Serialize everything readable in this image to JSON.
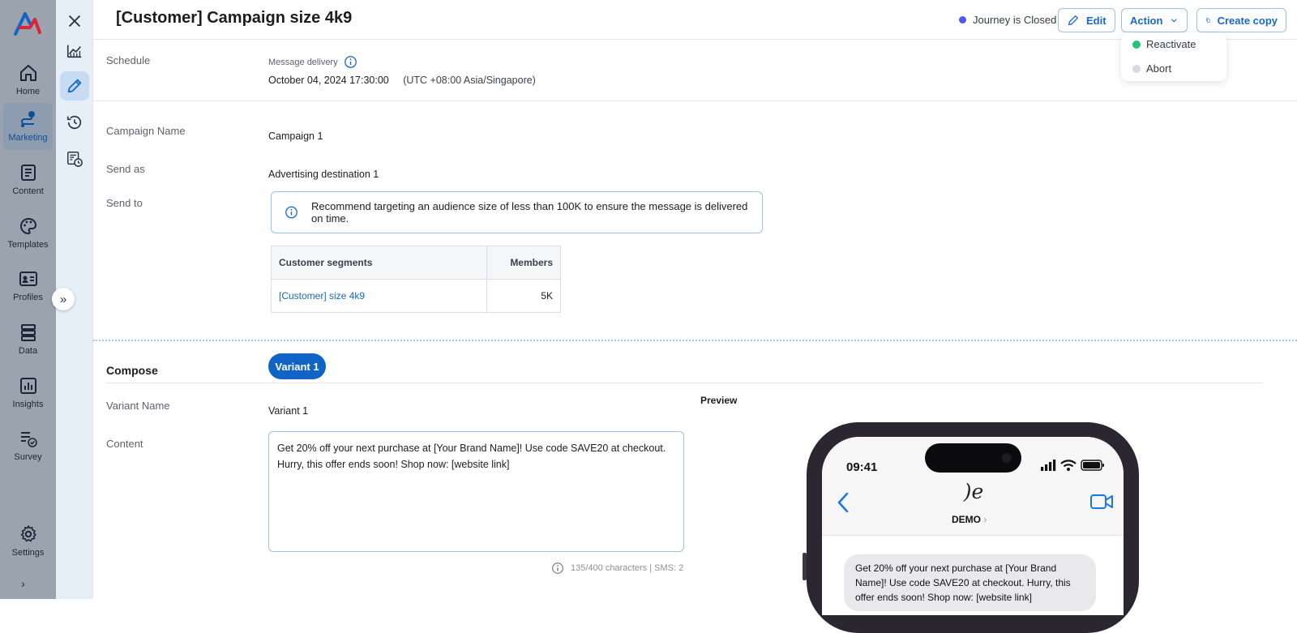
{
  "nav": {
    "items": [
      {
        "label": "Home",
        "icon": "home-icon"
      },
      {
        "label": "Marketing",
        "icon": "marketing-icon"
      },
      {
        "label": "Content",
        "icon": "content-icon"
      },
      {
        "label": "Templates",
        "icon": "palette-icon"
      },
      {
        "label": "Profiles",
        "icon": "profile-card-icon"
      },
      {
        "label": "Data",
        "icon": "database-icon"
      },
      {
        "label": "Insights",
        "icon": "insights-icon"
      },
      {
        "label": "Survey",
        "icon": "survey-icon"
      },
      {
        "label": "Settings",
        "icon": "gear-icon"
      }
    ],
    "active": "Marketing"
  },
  "header": {
    "title": "[Customer] Campaign size 4k9",
    "status_text": "Journey is Closed",
    "edit_label": "Edit",
    "action_label": "Action",
    "create_copy_label": "Create copy"
  },
  "action_menu": {
    "items": [
      {
        "label": "Reactivate",
        "color": "#22c37a"
      },
      {
        "label": "Abort",
        "color": "#d5dae1"
      }
    ]
  },
  "schedule": {
    "label": "Schedule",
    "delivery_label": "Message delivery",
    "datetime": "October 04, 2024 17:30:00",
    "timezone": "(UTC +08:00 Asia/Singapore)"
  },
  "campaign": {
    "name_label": "Campaign Name",
    "name_value": "Campaign 1",
    "send_as_label": "Send as",
    "send_as_value": "Advertising destination 1",
    "send_to_label": "Send to",
    "info_text": "Recommend targeting an audience size of less than 100K to ensure the message is delivered on time.",
    "table": {
      "headers": [
        "Customer segments",
        "Members"
      ],
      "rows": [
        {
          "segment": "[Customer] size 4k9",
          "members": "5K"
        }
      ]
    }
  },
  "compose": {
    "title": "Compose",
    "variant_tab": "Variant 1",
    "variant_name_label": "Variant Name",
    "variant_name_value": "Variant 1",
    "content_label": "Content",
    "content_text": "Get 20% off your next purchase at [Your Brand Name]! Use code SAVE20 at checkout. Hurry, this offer ends soon! Shop now: [website link]",
    "counter": "135/400 characters | SMS: 2",
    "preview_label": "Preview"
  },
  "phone": {
    "time": "09:41",
    "contact": "DEMO",
    "avatar_text": ")e",
    "message": "Get 20% off your next purchase at [Your Brand Name]! Use code SAVE20 at checkout. Hurry, this offer ends soon! Shop now: [website link]"
  },
  "colors": {
    "accent": "#0f64c6",
    "status_dot": "#4f5bef",
    "nav_bg": "#9ba3af"
  }
}
